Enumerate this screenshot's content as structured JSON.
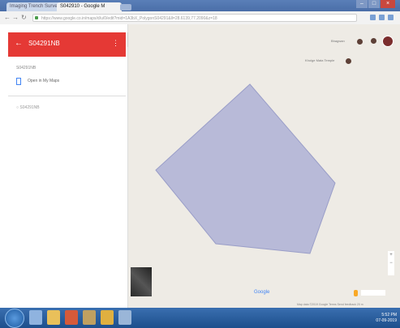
{
  "browser": {
    "tab_inactive_label": "Imaging Trench Survey",
    "tab_active_label": "S042910 - Google M",
    "url": "https://www.google.co.in/maps/d/u/0/edit?mid=1A3bX_PolygonS04291&ll=28.6139,77.2090&z=18",
    "window_minimize": "–",
    "window_maximize": "□",
    "window_close": "×"
  },
  "panel": {
    "title": "S04291NB",
    "back_icon": "arrow-left-icon",
    "more_icon": "more-vert-icon",
    "meta": "S04291NB",
    "open_label": "Open in My Maps",
    "layer_label": "S04291NB",
    "collapse_label": "‹"
  },
  "map": {
    "place_label_1": "Bhagwan",
    "place_label_2": "Kholge Mata Temple",
    "logo": "Google",
    "zoom_in": "+",
    "zoom_out": "−",
    "footer": "Map data ©2019 Google   Terms   Send feedback   20 m",
    "polygon_color": "#aeb2d6"
  },
  "taskbar": {
    "clock_time": "5:52 PM",
    "clock_date": "07-09-2019"
  }
}
